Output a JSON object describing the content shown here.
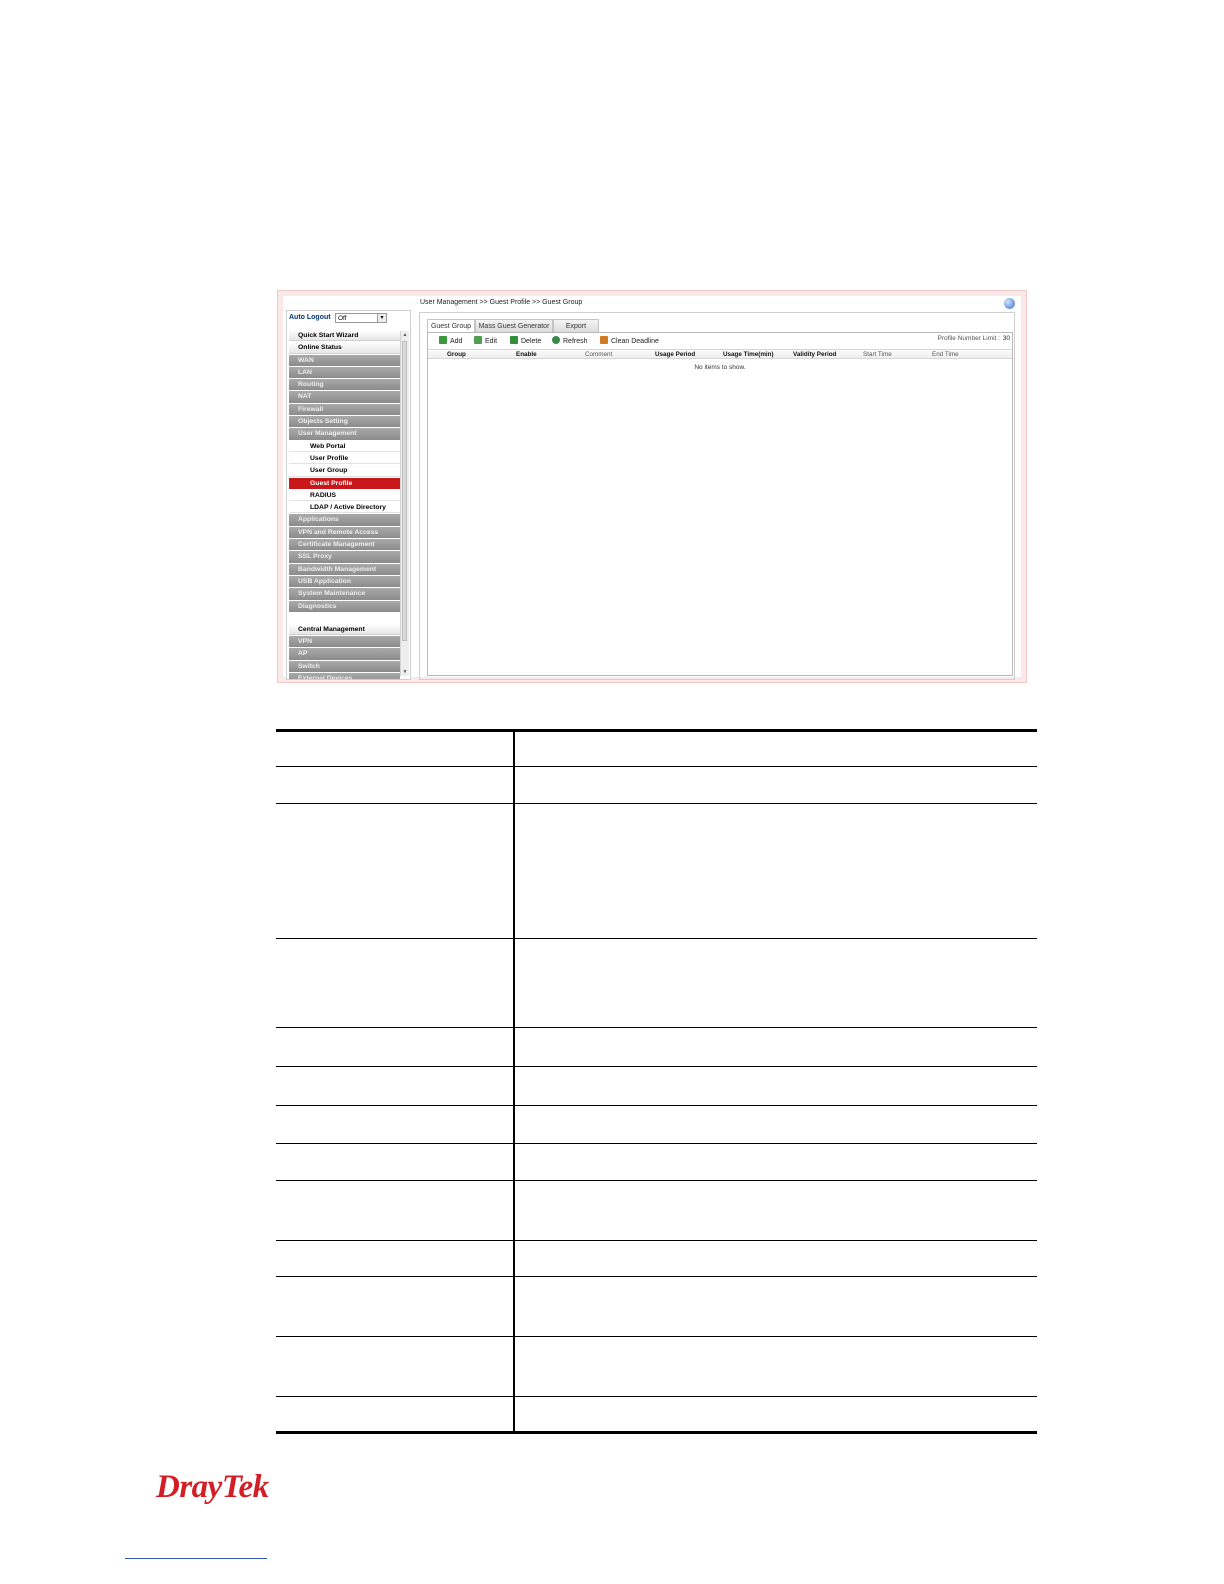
{
  "screenshot": {
    "breadcrumb": "User Management >> Guest Profile >> Guest Group",
    "auto_logout": {
      "label": "Auto Logout",
      "value": "Off"
    },
    "menu": [
      {
        "label": "Quick Start Wizard",
        "style": "light"
      },
      {
        "label": "Online Status",
        "style": "light"
      },
      {
        "label": "WAN",
        "style": "dark"
      },
      {
        "label": "LAN",
        "style": "dark"
      },
      {
        "label": "Routing",
        "style": "dark"
      },
      {
        "label": "NAT",
        "style": "dark"
      },
      {
        "label": "Firewall",
        "style": "dark"
      },
      {
        "label": "Objects Setting",
        "style": "dark"
      },
      {
        "label": "User Management",
        "style": "dark"
      },
      {
        "label": "Web Portal",
        "style": "sub"
      },
      {
        "label": "User Profile",
        "style": "sub"
      },
      {
        "label": "User Group",
        "style": "sub"
      },
      {
        "label": "Guest Profile",
        "style": "active"
      },
      {
        "label": "RADIUS",
        "style": "sub"
      },
      {
        "label": "LDAP / Active Directory",
        "style": "sub"
      },
      {
        "label": "Applications",
        "style": "dark"
      },
      {
        "label": "VPN and Remote Access",
        "style": "dark"
      },
      {
        "label": "Certificate Management",
        "style": "dark"
      },
      {
        "label": "SSL Proxy",
        "style": "dark"
      },
      {
        "label": "Bandwidth Management",
        "style": "dark"
      },
      {
        "label": "USB Application",
        "style": "dark"
      },
      {
        "label": "System Maintenance",
        "style": "dark"
      },
      {
        "label": "Diagnostics",
        "style": "dark"
      },
      {
        "label": "",
        "style": "gap"
      },
      {
        "label": "Central Management",
        "style": "light"
      },
      {
        "label": "VPN",
        "style": "dark"
      },
      {
        "label": "AP",
        "style": "dark"
      },
      {
        "label": "Switch",
        "style": "dark"
      },
      {
        "label": "External Devices",
        "style": "dark"
      }
    ],
    "tabs": [
      "Guest Group",
      "Mass Guest Generator",
      "Export"
    ],
    "toolbar": {
      "add": "Add",
      "edit": "Edit",
      "delete": "Delete",
      "refresh": "Refresh",
      "clean_deadline": "Clean Deadline",
      "profile_limit_label": "Profile Number Limit :",
      "profile_limit_value": "30"
    },
    "columns": [
      "Group",
      "Enable",
      "Comment",
      "Usage Period",
      "Usage Time(min)",
      "Validity Period",
      "Start Time",
      "End Time"
    ],
    "empty_message": "No items to show."
  },
  "description_table": {
    "rows": 13
  },
  "footer": {
    "logo": "DrayTek"
  }
}
